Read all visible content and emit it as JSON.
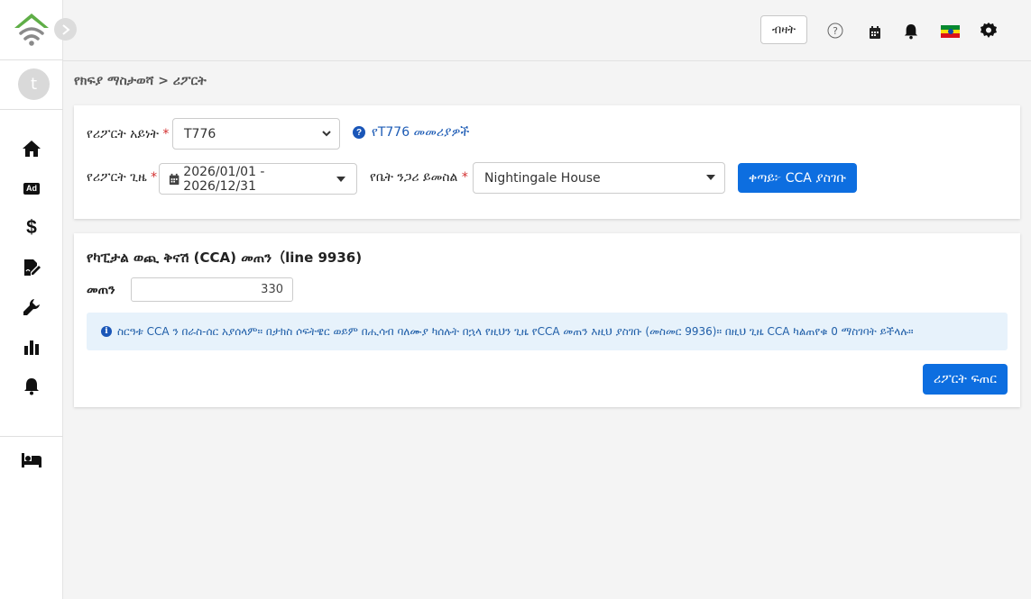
{
  "sidebar": {
    "avatar_initial": "t",
    "items": [
      {
        "icon": "home-icon"
      },
      {
        "icon": "ad-icon",
        "text": "Ad"
      },
      {
        "icon": "dollar-icon",
        "text": "$"
      },
      {
        "icon": "file-signature-icon"
      },
      {
        "icon": "wrench-icon"
      },
      {
        "icon": "bar-chart-icon"
      },
      {
        "icon": "bell-icon"
      },
      {
        "icon": "bed-icon"
      }
    ]
  },
  "topbar": {
    "login_label": "ብዛት",
    "icons": [
      "help-circle-icon",
      "calendar-icon",
      "bell-icon",
      "ethiopia-flag-icon",
      "gear-icon"
    ]
  },
  "breadcrumb": {
    "parent": "የክፍያ ማስታወሻ",
    "separator": ">",
    "current": "ሪፖርት"
  },
  "filters": {
    "report_type_label": "የሪፖርት አይነት",
    "report_type_value": "T776",
    "help_link": "የT776 መመሪያዎች",
    "period_label": "የሪፖርት ጊዜ",
    "period_value": "2026/01/01 - 2026/12/31",
    "property_label": "የቤት ንጋሪ ይመስል",
    "property_value": "Nightingale House",
    "continue_button": "ቀጣይ፦ CCA ያስገቡ",
    "required_mark": "*"
  },
  "cca": {
    "title": "የካፒታል ወጪ ቅናሽ (CCA) መጠን（line 9936)",
    "amount_label": "መጠን",
    "amount_value": "330",
    "info_text": "ስርዓቱ CCA ን በራስ-ሰር አያሰላም። በታክስ ሶፍትዌር ወይም በሒሳብ ባለሙያ ካሰሉት በኋላ የዚህን ጊዜ የCCA መጠን እዚህ ያስገቡ (መስመር 9936)። በዚህ ጊዜ CCA ካልጠየቁ 0 ማስገባት ይችላሉ።",
    "generate_button": "ሪፖርት ፍጠር"
  },
  "colors": {
    "primary": "#0d6ee0",
    "info_bg": "#e7f2fb",
    "logo_green": "#5fae47",
    "logo_gray": "#8a8a8a"
  }
}
